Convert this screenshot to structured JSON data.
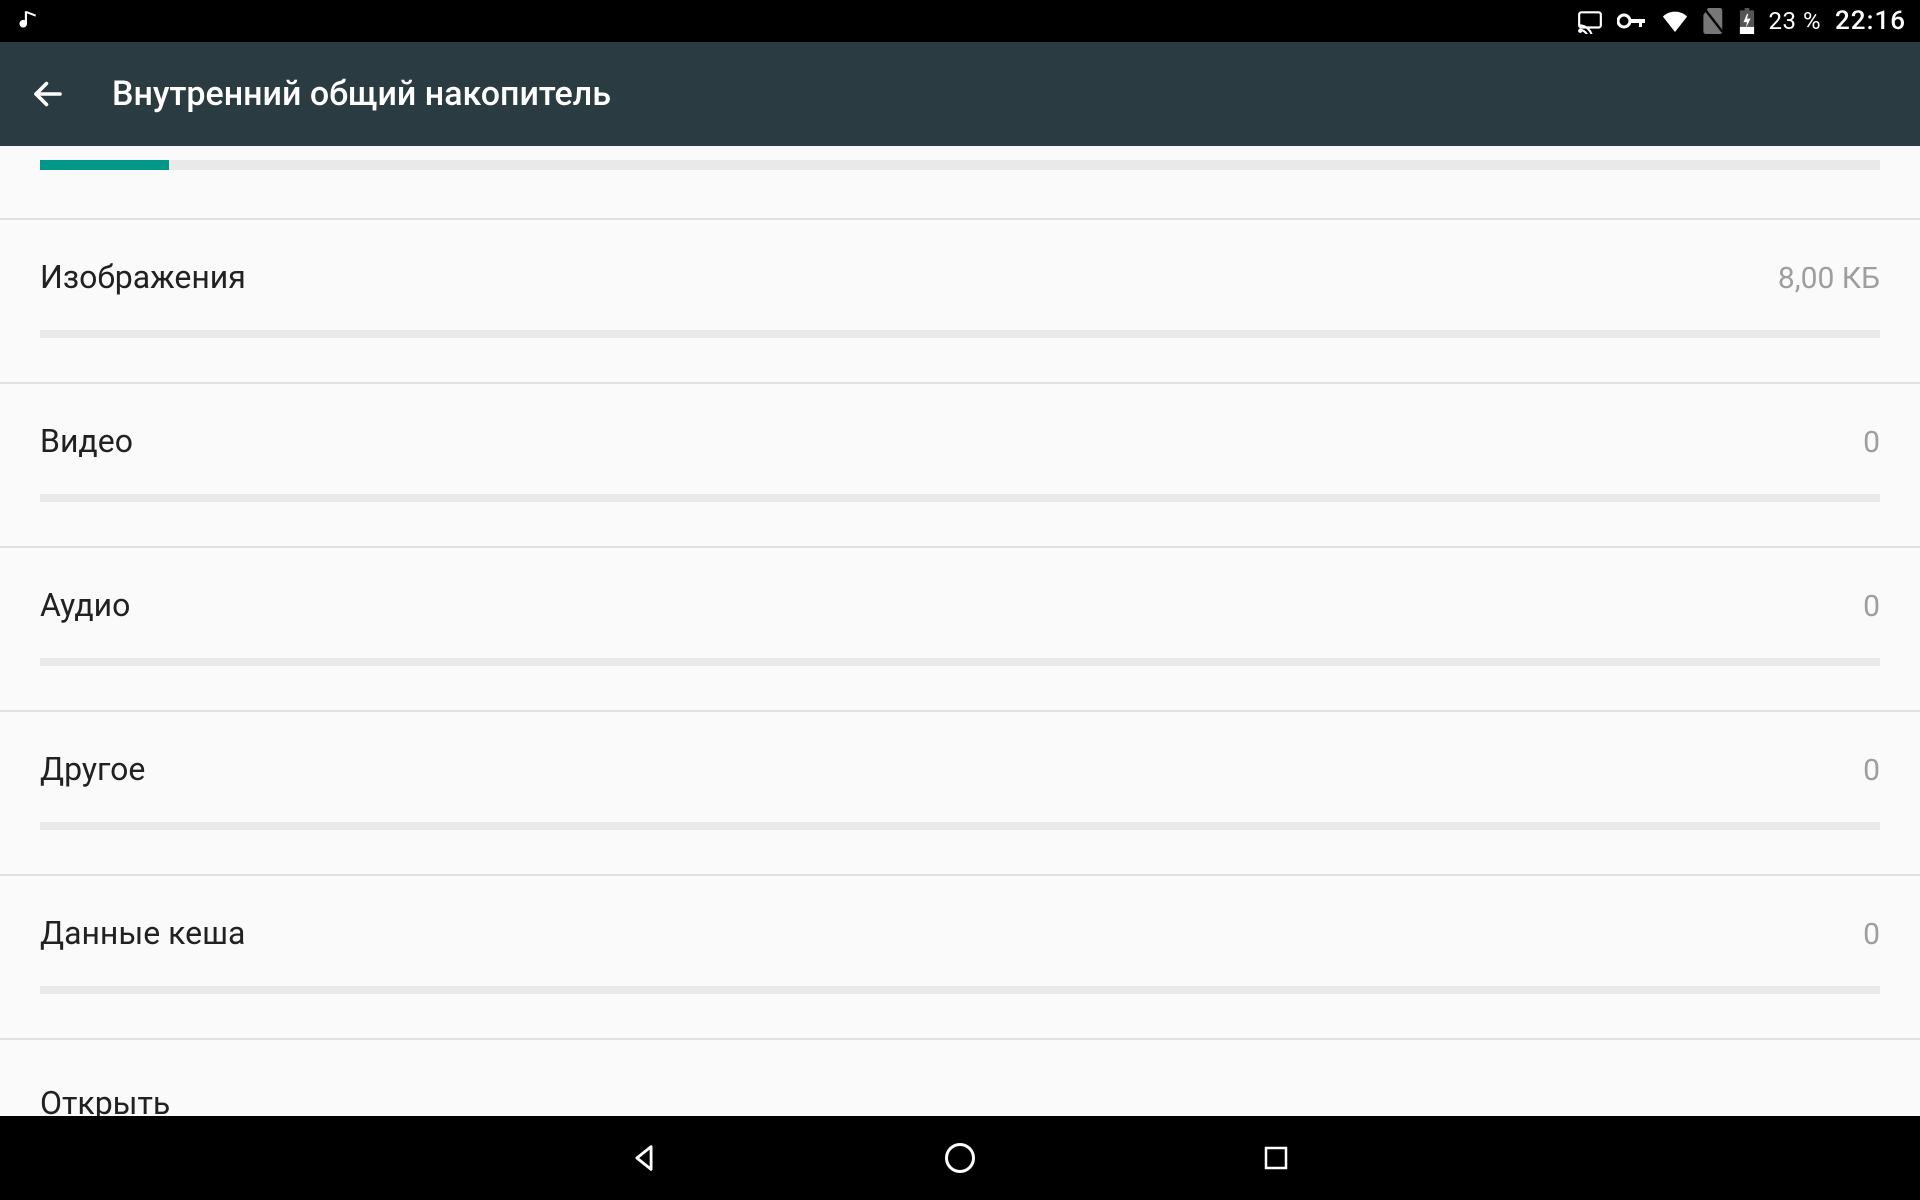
{
  "status": {
    "battery_pct": "23 %",
    "time": "22:16"
  },
  "appbar": {
    "title": "Внутренний общий накопитель"
  },
  "top_progress_pct": 7,
  "rows": [
    {
      "label": "Изображения",
      "value": "8,00 КБ",
      "fill_pct": 0
    },
    {
      "label": "Видео",
      "value": "0",
      "fill_pct": 0
    },
    {
      "label": "Аудио",
      "value": "0",
      "fill_pct": 0
    },
    {
      "label": "Другое",
      "value": "0",
      "fill_pct": 0
    },
    {
      "label": "Данные кеша",
      "value": "0",
      "fill_pct": 0
    }
  ],
  "open_label": "Открыть",
  "colors": {
    "accent": "#009688",
    "appbar": "#2a3b41"
  }
}
